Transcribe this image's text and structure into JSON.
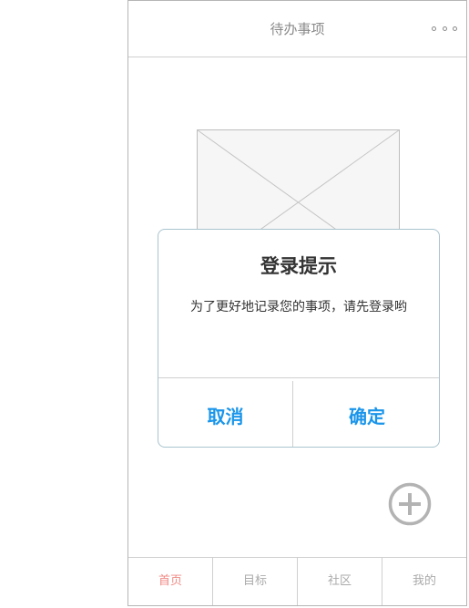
{
  "header": {
    "title": "待办事项",
    "more_icon": "more-dots-icon"
  },
  "placeholder": {
    "icon": "image-placeholder-icon"
  },
  "dialog": {
    "title": "登录提示",
    "message": "为了更好地记录您的事项，请先登录哟",
    "cancel_label": "取消",
    "confirm_label": "确定"
  },
  "fab": {
    "icon": "plus-circle-icon"
  },
  "tabbar": {
    "items": [
      {
        "label": "首页",
        "active": true
      },
      {
        "label": "目标",
        "active": false
      },
      {
        "label": "社区",
        "active": false
      },
      {
        "label": "我的",
        "active": false
      }
    ]
  },
  "colors": {
    "accent": "#1a95ea",
    "active_tab": "#f08a85",
    "border": "#b5b5b5"
  }
}
